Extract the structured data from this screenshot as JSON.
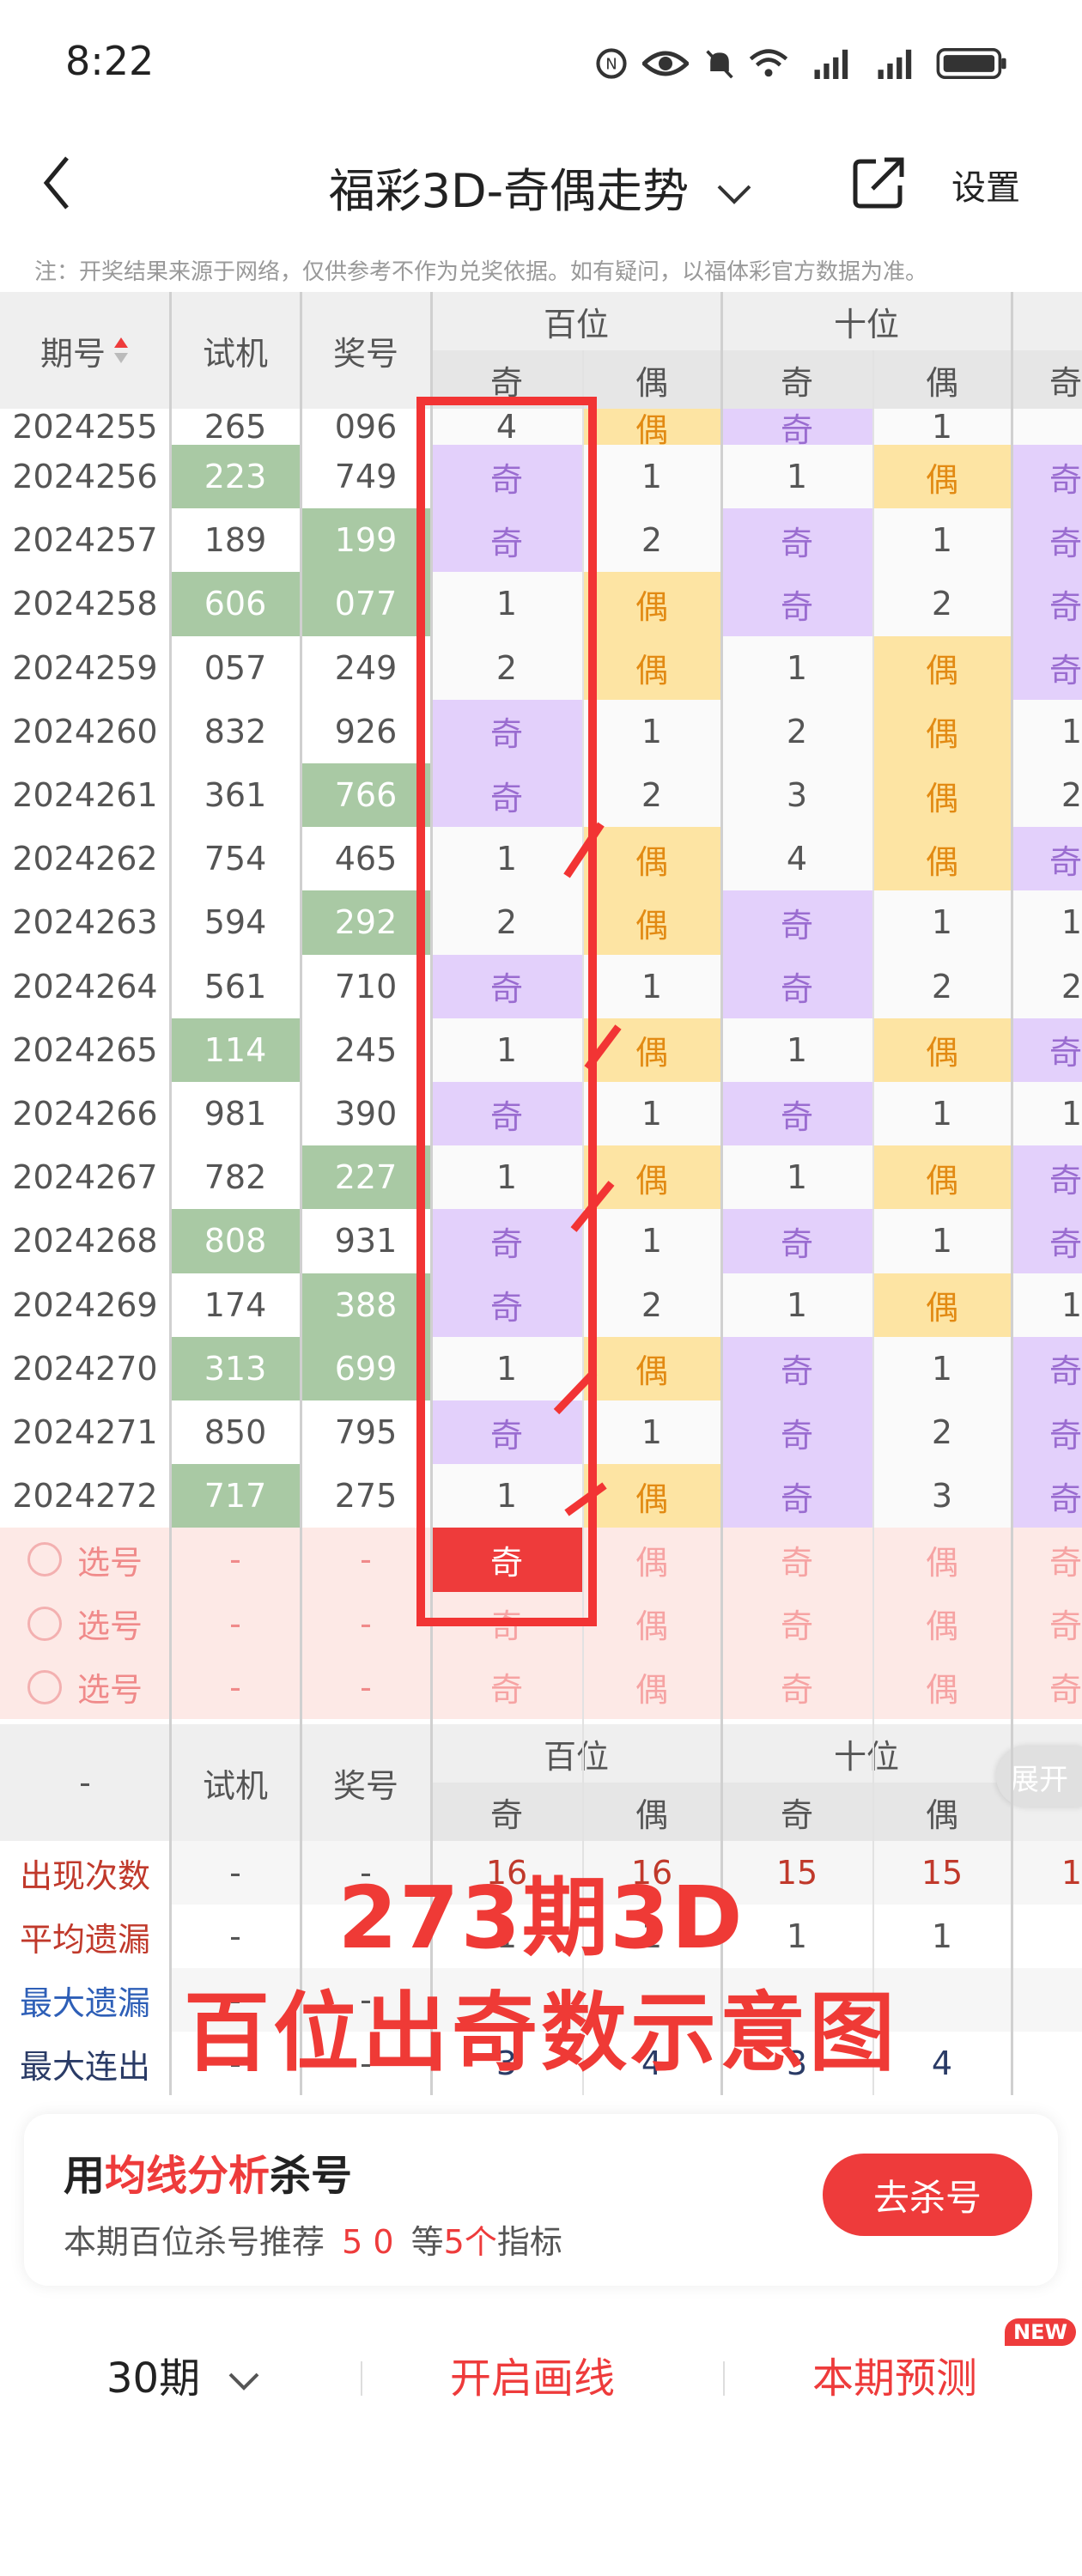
{
  "status_bar": {
    "time": "8:22"
  },
  "header": {
    "title": "福彩3D-奇偶走势",
    "settings": "设置"
  },
  "notice": "注：开奖结果来源于网络，仅供参考不作为兑奖依据。如有疑问，以福体彩官方数据为准。",
  "table": {
    "col_issue": "期号",
    "col_trial": "试机",
    "col_draw": "奖号",
    "group_hundreds": "百位",
    "group_tens": "十位",
    "sub_odd": "奇",
    "sub_even": "偶",
    "rows": [
      {
        "issue": "2024255",
        "trial": "265",
        "draw": "096",
        "h": [
          "4",
          "偶"
        ],
        "t": [
          "奇",
          "1"
        ],
        "x": "",
        "trial_hl": false,
        "draw_hl": false
      },
      {
        "issue": "2024256",
        "trial": "223",
        "draw": "749",
        "h": [
          "奇",
          "1"
        ],
        "t": [
          "1",
          "偶"
        ],
        "x": "奇",
        "trial_hl": true,
        "draw_hl": false
      },
      {
        "issue": "2024257",
        "trial": "189",
        "draw": "199",
        "h": [
          "奇",
          "2"
        ],
        "t": [
          "奇",
          "1"
        ],
        "x": "奇",
        "trial_hl": false,
        "draw_hl": true
      },
      {
        "issue": "2024258",
        "trial": "606",
        "draw": "077",
        "h": [
          "1",
          "偶"
        ],
        "t": [
          "奇",
          "2"
        ],
        "x": "奇",
        "trial_hl": true,
        "draw_hl": true
      },
      {
        "issue": "2024259",
        "trial": "057",
        "draw": "249",
        "h": [
          "2",
          "偶"
        ],
        "t": [
          "1",
          "偶"
        ],
        "x": "奇",
        "trial_hl": false,
        "draw_hl": false
      },
      {
        "issue": "2024260",
        "trial": "832",
        "draw": "926",
        "h": [
          "奇",
          "1"
        ],
        "t": [
          "2",
          "偶"
        ],
        "x": "1",
        "trial_hl": false,
        "draw_hl": false
      },
      {
        "issue": "2024261",
        "trial": "361",
        "draw": "766",
        "h": [
          "奇",
          "2"
        ],
        "t": [
          "3",
          "偶"
        ],
        "x": "2",
        "trial_hl": false,
        "draw_hl": true
      },
      {
        "issue": "2024262",
        "trial": "754",
        "draw": "465",
        "h": [
          "1",
          "偶"
        ],
        "t": [
          "4",
          "偶"
        ],
        "x": "奇",
        "trial_hl": false,
        "draw_hl": false
      },
      {
        "issue": "2024263",
        "trial": "594",
        "draw": "292",
        "h": [
          "2",
          "偶"
        ],
        "t": [
          "奇",
          "1"
        ],
        "x": "1",
        "trial_hl": false,
        "draw_hl": true
      },
      {
        "issue": "2024264",
        "trial": "561",
        "draw": "710",
        "h": [
          "奇",
          "1"
        ],
        "t": [
          "奇",
          "2"
        ],
        "x": "2",
        "trial_hl": false,
        "draw_hl": false
      },
      {
        "issue": "2024265",
        "trial": "114",
        "draw": "245",
        "h": [
          "1",
          "偶"
        ],
        "t": [
          "1",
          "偶"
        ],
        "x": "奇",
        "trial_hl": true,
        "draw_hl": false
      },
      {
        "issue": "2024266",
        "trial": "981",
        "draw": "390",
        "h": [
          "奇",
          "1"
        ],
        "t": [
          "奇",
          "1"
        ],
        "x": "1",
        "trial_hl": false,
        "draw_hl": false
      },
      {
        "issue": "2024267",
        "trial": "782",
        "draw": "227",
        "h": [
          "1",
          "偶"
        ],
        "t": [
          "1",
          "偶"
        ],
        "x": "奇",
        "trial_hl": false,
        "draw_hl": true
      },
      {
        "issue": "2024268",
        "trial": "808",
        "draw": "931",
        "h": [
          "奇",
          "1"
        ],
        "t": [
          "奇",
          "1"
        ],
        "x": "奇",
        "trial_hl": true,
        "draw_hl": false
      },
      {
        "issue": "2024269",
        "trial": "174",
        "draw": "388",
        "h": [
          "奇",
          "2"
        ],
        "t": [
          "1",
          "偶"
        ],
        "x": "1",
        "trial_hl": false,
        "draw_hl": true
      },
      {
        "issue": "2024270",
        "trial": "313",
        "draw": "699",
        "h": [
          "1",
          "偶"
        ],
        "t": [
          "奇",
          "1"
        ],
        "x": "奇",
        "trial_hl": true,
        "draw_hl": true
      },
      {
        "issue": "2024271",
        "trial": "850",
        "draw": "795",
        "h": [
          "奇",
          "1"
        ],
        "t": [
          "奇",
          "2"
        ],
        "x": "奇",
        "trial_hl": false,
        "draw_hl": false
      },
      {
        "issue": "2024272",
        "trial": "717",
        "draw": "275",
        "h": [
          "1",
          "偶"
        ],
        "t": [
          "奇",
          "3"
        ],
        "x": "奇",
        "trial_hl": true,
        "draw_hl": false
      }
    ],
    "select_label": "选号",
    "dash": "-",
    "selected_value": "奇",
    "expand": "展开",
    "stats_labels": [
      "出现次数",
      "平均遗漏",
      "最大遗漏",
      "最大连出"
    ],
    "stats_values": [
      [
        "-",
        "-",
        "16",
        "16",
        "15",
        "15",
        "1"
      ],
      [
        "-",
        "-",
        "1",
        "1",
        "1",
        "1",
        ""
      ],
      [
        "-",
        "-",
        "",
        "",
        "",
        "",
        ""
      ],
      [
        "-",
        "-",
        "3",
        "4",
        "3",
        "4",
        ""
      ]
    ]
  },
  "overlay": {
    "line1": "273期3D",
    "line2": "百位出奇数示意图"
  },
  "promo": {
    "prefix": "用",
    "highlight": "均线分析",
    "suffix": "杀号",
    "sub_prefix": "本期百位杀号推荐",
    "sub_nums": "5 0",
    "sub_mid": "等",
    "sub_count": "5个",
    "sub_suffix": "指标",
    "button": "去杀号"
  },
  "tabbar": {
    "period": "30期",
    "draw_line": "开启画线",
    "predict": "本期预测",
    "badge": "NEW"
  },
  "colors": {
    "odd_bg": "#e3d0fb",
    "even_bg": "#fde4a3",
    "green": "#a9c9a4",
    "red": "#ee3b3b",
    "pink": "#fde9e6"
  }
}
